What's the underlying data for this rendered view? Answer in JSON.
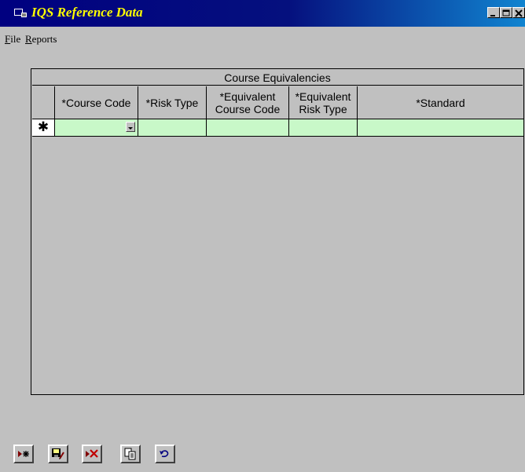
{
  "window": {
    "title": "IQS Reference Data",
    "controls": [
      "minimize",
      "maximize",
      "close"
    ]
  },
  "menu": {
    "file": {
      "accel": "F",
      "rest": "ile"
    },
    "reports": {
      "accel": "R",
      "rest": "eports"
    }
  },
  "grid": {
    "caption": "Course Equivalencies",
    "columns": [
      {
        "line1": "*Course Code",
        "line2": ""
      },
      {
        "line1": "*Risk Type",
        "line2": ""
      },
      {
        "line1": "*Equivalent",
        "line2": "Course Code"
      },
      {
        "line1": "*Equivalent",
        "line2": "Risk Type"
      },
      {
        "line1": "*Standard",
        "line2": ""
      }
    ],
    "new_row_marker": "✱",
    "new_row_color": "#c8f8c8"
  },
  "toolbar": [
    {
      "name": "new-record-icon"
    },
    {
      "name": "save-icon"
    },
    {
      "name": "delete-icon"
    },
    {
      "name": "copy-icon"
    },
    {
      "name": "undo-icon"
    }
  ]
}
